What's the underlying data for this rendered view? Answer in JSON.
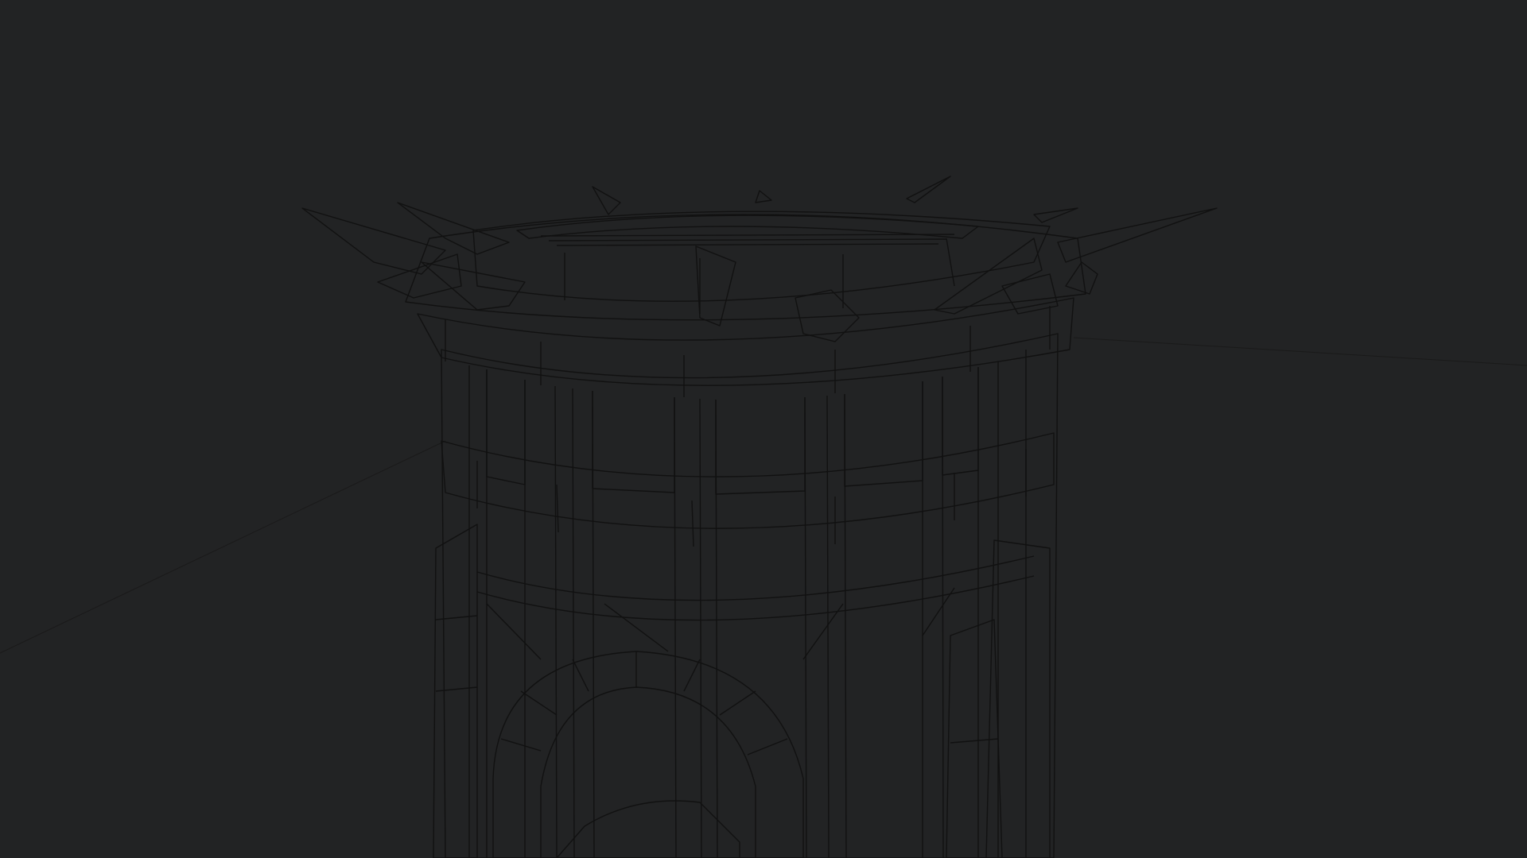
{
  "viewport": {
    "label": "",
    "background_color": "#222324",
    "model_color": "#e9e6e3",
    "wire_color": "#111111",
    "render_mode": "wireframe-on-shaded",
    "subject": "tower-model"
  }
}
